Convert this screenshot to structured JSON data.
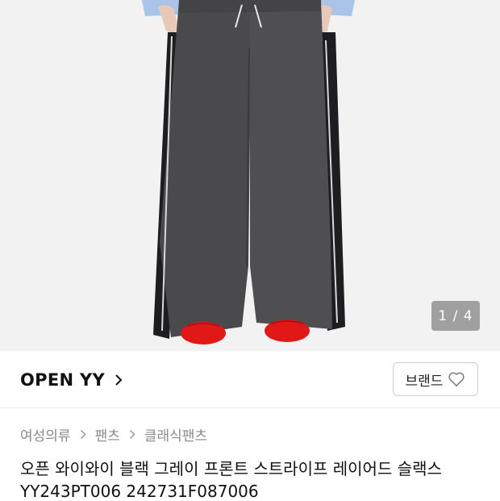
{
  "gallery": {
    "counter": "1 / 4"
  },
  "brand": {
    "name": "OPEN YY",
    "button_label": "브랜드"
  },
  "breadcrumb": [
    "여성의류",
    "팬츠",
    "클래식팬츠"
  ],
  "product": {
    "title": "오픈 와이와이 블랙 그레이 프론트 스트라이프 레이어드 슬랙스",
    "code": "YY243PT006 242731F087006"
  },
  "colors": {
    "hero_bg": "#f2f2f2",
    "pants": "#4a4a4c",
    "shoes": "#e01818",
    "shirt": "#a9c4e6"
  }
}
